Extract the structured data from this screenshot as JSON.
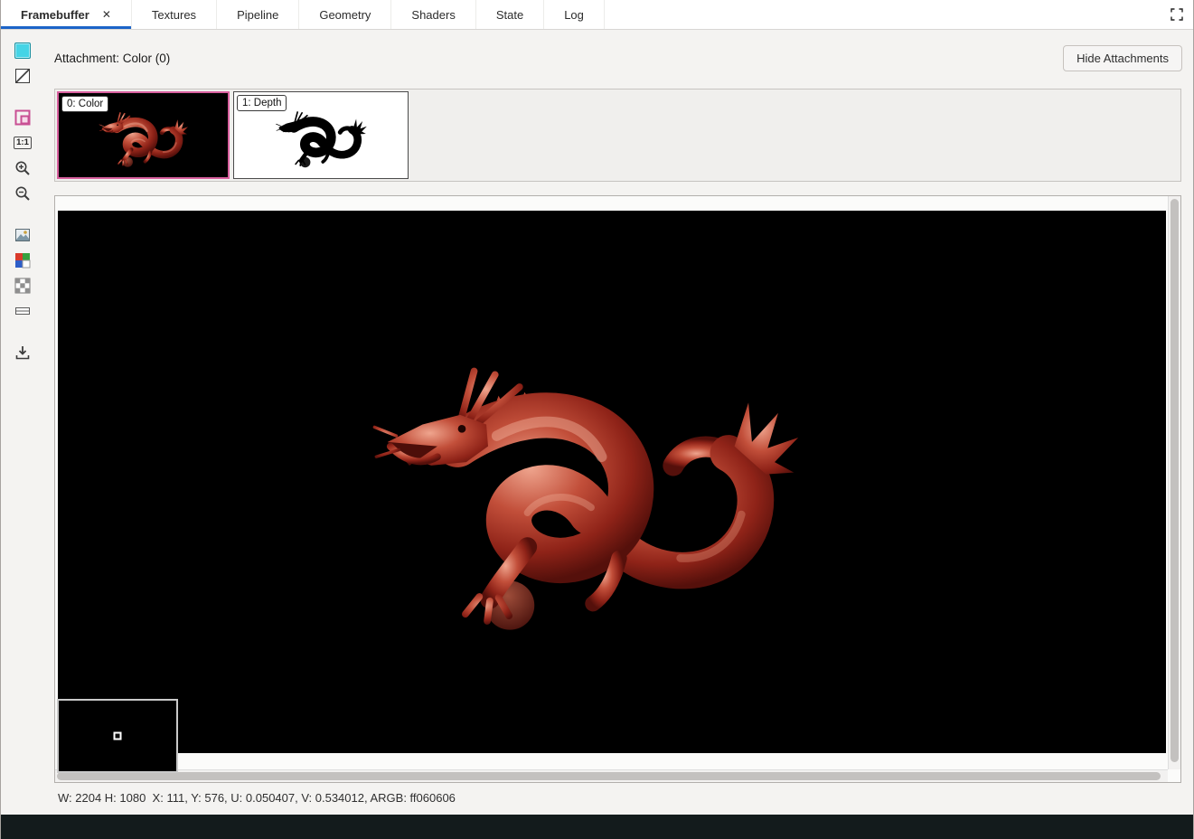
{
  "colors": {
    "accent_blue": "#1c64c8",
    "selection_pink": "#d9619f",
    "canvas_black": "#000000",
    "swatch_cyan": "#45d4e6",
    "picked_pixel": "#060606"
  },
  "tab_bar": {
    "tabs": [
      {
        "label": "Framebuffer",
        "active": true
      },
      {
        "label": "Textures",
        "active": false
      },
      {
        "label": "Pipeline",
        "active": false
      },
      {
        "label": "Geometry",
        "active": false
      },
      {
        "label": "Shaders",
        "active": false
      },
      {
        "label": "State",
        "active": false
      },
      {
        "label": "Log",
        "active": false
      }
    ],
    "close_glyph": "✕"
  },
  "header": {
    "attachment_label": "Attachment: Color (0)",
    "hide_attachments_button": "Hide Attachments"
  },
  "toolbar": {
    "zoom_one_to_one": "1:1",
    "icons": {
      "background_swatch": "cyan-square",
      "alpha_background": "slashed-square",
      "flip": "pink-square",
      "zoom_100": "1:1-box",
      "zoom_in": "magnifier-plus",
      "zoom_out": "magnifier-minus",
      "fit_image": "picture",
      "rgb_channels": "rgb-grid",
      "checkerboard": "checker-grid",
      "range_bar": "horizontal-bar",
      "save": "download-arrow"
    }
  },
  "attachments": [
    {
      "label": "0: Color",
      "selected": true
    },
    {
      "label": "1: Depth",
      "selected": false
    }
  ],
  "status_bar": {
    "text": "W: 2204 H: 1080  X: 111, Y: 576, U: 0.050407, V: 0.534012, ARGB: ff060606"
  }
}
